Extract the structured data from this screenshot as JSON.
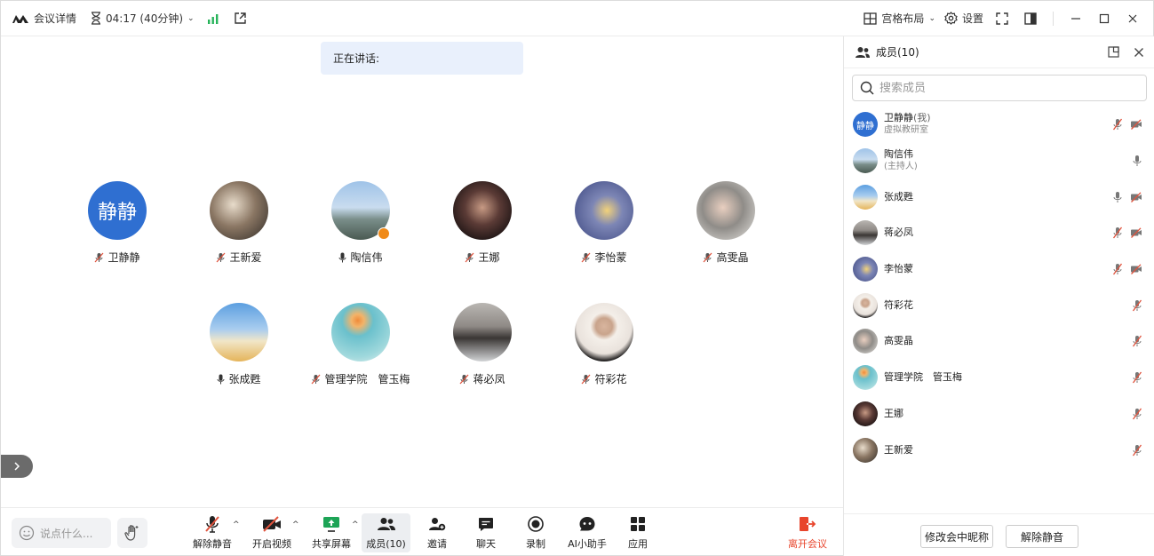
{
  "topbar": {
    "meeting_details": "会议详情",
    "timer": "04:17 (40分钟)",
    "layout": "宫格布局",
    "settings": "设置"
  },
  "main": {
    "speaking_label": "正在讲话:",
    "participants": [
      {
        "name": "卫静静",
        "avatar_text": "静静",
        "mic": "muted"
      },
      {
        "name": "王新爱",
        "mic": "muted"
      },
      {
        "name": "陶信伟",
        "mic": "on",
        "host": true
      },
      {
        "name": "王娜",
        "mic": "muted"
      },
      {
        "name": "李怡蒙",
        "mic": "muted"
      },
      {
        "name": "高雯晶",
        "mic": "muted"
      },
      {
        "name": "张成甦",
        "mic": "on"
      },
      {
        "name": "管理学院　管玉梅",
        "mic": "muted"
      },
      {
        "name": "蒋必凤",
        "mic": "muted"
      },
      {
        "name": "符彩花",
        "mic": "muted"
      }
    ]
  },
  "toolbar": {
    "chat_placeholder": "说点什么...",
    "unmute": "解除静音",
    "start_video": "开启视频",
    "share_screen": "共享屏幕",
    "members": "成员(10)",
    "invite": "邀请",
    "chat": "聊天",
    "record": "录制",
    "ai_assistant": "AI小助手",
    "apps": "应用",
    "leave": "离开会议"
  },
  "sidebar": {
    "title": "成员(10)",
    "search_placeholder": "搜索成员",
    "members": [
      {
        "name": "卫静静",
        "me_tag": "(我)",
        "sub": "虚拟教研室",
        "avatar_text": "静静",
        "mic": "muted",
        "video": "off"
      },
      {
        "name": "陶信伟",
        "sub": "(主持人)",
        "mic": "on",
        "video": "none"
      },
      {
        "name": "张成甦",
        "sub": "",
        "mic": "on",
        "video": "off"
      },
      {
        "name": "蒋必凤",
        "sub": "",
        "mic": "muted",
        "video": "off"
      },
      {
        "name": "李怡蒙",
        "sub": "",
        "mic": "muted",
        "video": "off"
      },
      {
        "name": "符彩花",
        "sub": "",
        "mic": "muted",
        "video": "none"
      },
      {
        "name": "高雯晶",
        "sub": "",
        "mic": "muted",
        "video": "none"
      },
      {
        "name": "管理学院　管玉梅",
        "sub": "",
        "mic": "muted",
        "video": "none"
      },
      {
        "name": "王娜",
        "sub": "",
        "mic": "muted",
        "video": "none"
      },
      {
        "name": "王新爱",
        "sub": "",
        "mic": "muted",
        "video": "none"
      }
    ],
    "rename_button": "修改会中昵称",
    "unmute_button": "解除静音"
  },
  "colors": {
    "accent": "#2f6fd1",
    "speaking_bg": "#e9f0fc",
    "leave": "#e8452c",
    "signal": "#27b35a",
    "muted_icon": "#e0533d",
    "host_badge": "#f08a18"
  }
}
